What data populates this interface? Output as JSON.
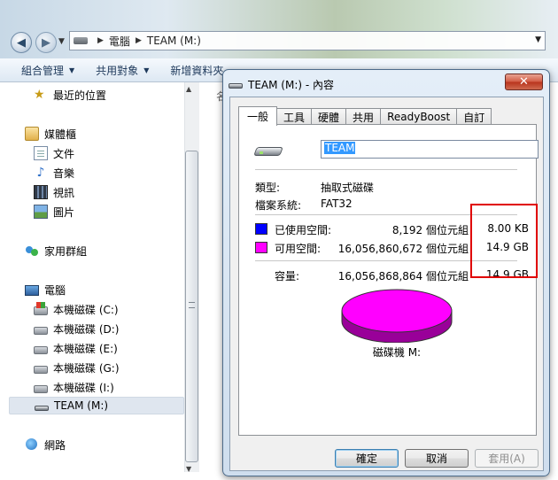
{
  "explorer": {
    "address": {
      "root": "電腦",
      "current": "TEAM (M:)"
    },
    "toolbar": {
      "organize": "組合管理",
      "share": "共用對象",
      "new_folder": "新增資料夾"
    },
    "sidebar": {
      "recent": "最近的位置",
      "libraries": "媒體櫃",
      "documents": "文件",
      "music": "音樂",
      "videos": "視訊",
      "pictures": "圖片",
      "homegroup": "家用群組",
      "computer": "電腦",
      "drives": [
        {
          "label": "本機磁碟 (C:)",
          "icon": "system-drive-icon"
        },
        {
          "label": "本機磁碟 (D:)",
          "icon": "hard-drive-icon"
        },
        {
          "label": "本機磁碟 (E:)",
          "icon": "hard-drive-icon"
        },
        {
          "label": "本機磁碟 (G:)",
          "icon": "hard-drive-icon"
        },
        {
          "label": "本機磁碟 (I:)",
          "icon": "hard-drive-icon"
        },
        {
          "label": "TEAM (M:)",
          "icon": "usb-drive-icon",
          "selected": true
        }
      ],
      "network": "網路"
    },
    "content_hint": "名"
  },
  "dialog": {
    "title": "TEAM (M:) - 內容",
    "close_glyph": "✕",
    "tabs": [
      "一般",
      "工具",
      "硬體",
      "共用",
      "ReadyBoost",
      "自訂"
    ],
    "active_tab": 0,
    "general": {
      "volume_name": "TEAM",
      "type_label": "類型:",
      "type_value": "抽取式磁碟",
      "fs_label": "檔案系統:",
      "fs_value": "FAT32",
      "used": {
        "label": "已使用空間:",
        "bytes": "8,192 個位元組",
        "size": "8.00 KB",
        "color": "#0000ff"
      },
      "free": {
        "label": "可用空間:",
        "bytes": "16,056,860,672 個位元組",
        "size": "14.9 GB",
        "color": "#ff00ff"
      },
      "capacity": {
        "label": "容量:",
        "bytes": "16,056,868,864 個位元組",
        "size": "14.9 GB"
      },
      "drive_caption": "磁碟機 M:"
    },
    "buttons": {
      "ok": "確定",
      "cancel": "取消",
      "apply": "套用(A)"
    }
  },
  "highlight_color": "#e00000"
}
